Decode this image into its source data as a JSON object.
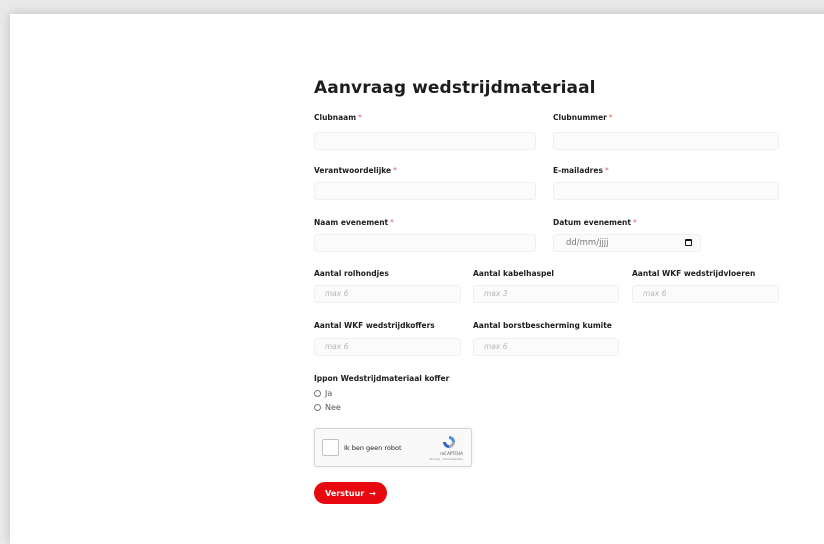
{
  "form": {
    "title": "Aanvraag wedstrijdmateriaal",
    "required_marker": "*",
    "fields": {
      "clubnaam": {
        "label": "Clubnaam"
      },
      "clubnummer": {
        "label": "Clubnummer"
      },
      "verantwoordelijke": {
        "label": "Verantwoordelijke"
      },
      "email": {
        "label": "E-mailadres"
      },
      "naam_evenement": {
        "label": "Naam evenement"
      },
      "datum_evenement": {
        "label": "Datum evenement",
        "value": "dd/mm/jjjj"
      },
      "rolhondjes": {
        "label": "Aantal rolhondjes",
        "placeholder": "max 6"
      },
      "kabelhaspel": {
        "label": "Aantal kabelhaspel",
        "placeholder": "max 3"
      },
      "wedstrijdvloeren": {
        "label": "Aantal WKF wedstrijdvloeren",
        "placeholder": "max 6"
      },
      "wedstrijdkoffers": {
        "label": "Aantal WKF wedstrijdkoffers",
        "placeholder": "max 6"
      },
      "borstbescherming": {
        "label": "Aantal borstbescherming kumite",
        "placeholder": "max 6"
      }
    },
    "koffer": {
      "label": "Ippon Wedstrijdmateriaal koffer",
      "options": [
        "Ja",
        "Nee"
      ]
    },
    "captcha": {
      "text": "Ik ben geen robot",
      "brand": "reCAPTCHA",
      "links": "Privacy - Voorwaarden"
    },
    "submit": {
      "label": "Verstuur",
      "icon": "arrow-right-icon"
    }
  },
  "colors": {
    "accent": "#e8080f",
    "required": "#e35b5b"
  }
}
